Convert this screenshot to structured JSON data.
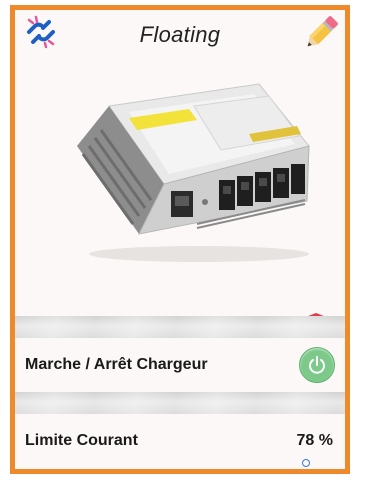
{
  "header": {
    "title": "Floating",
    "left_icon": "unlinked-chain-icon",
    "right_icon": "pencil-icon"
  },
  "product": {
    "image": "battery-charger-image",
    "alert_icon": "shield-prohibited-icon"
  },
  "rows": {
    "power": {
      "label": "Marche / Arrêt Chargeur",
      "icon": "power-icon",
      "state": "on"
    },
    "current_limit": {
      "label": "Limite Courant",
      "value": "78 %"
    }
  },
  "colors": {
    "frame_border": "#ef8a2c",
    "power_green": "#7cc98a",
    "shield_red": "#e23b4a",
    "link_blue": "#1e5fc4"
  }
}
